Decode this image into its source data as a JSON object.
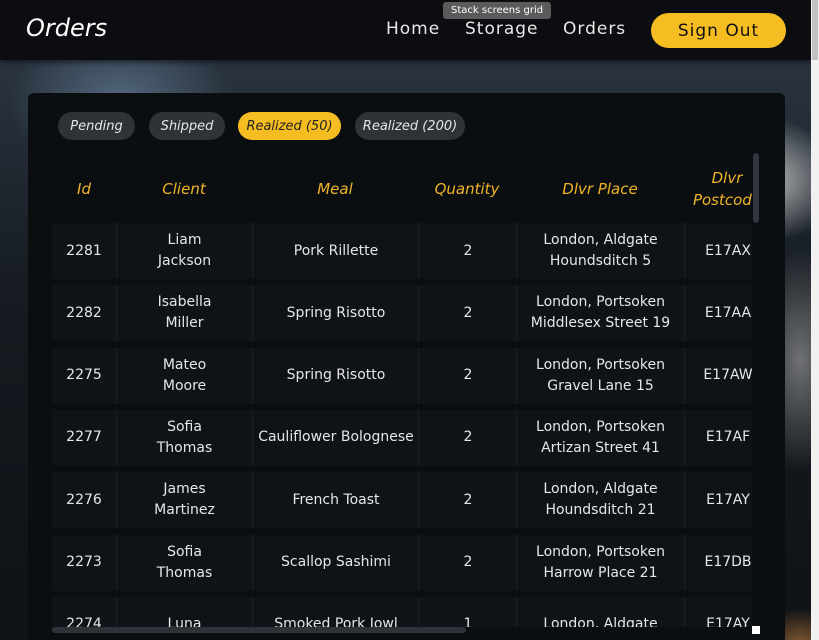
{
  "header": {
    "title": "Orders",
    "nav": [
      "Home",
      "Storage",
      "Orders"
    ],
    "tooltip": "Stack screens grid",
    "signout": "Sign Out"
  },
  "tabs": [
    {
      "label": "Pending",
      "active": false
    },
    {
      "label": "Shipped",
      "active": false
    },
    {
      "label": "Realized (50)",
      "active": true
    },
    {
      "label": "Realized (200)",
      "active": false
    }
  ],
  "table": {
    "columns": [
      "Id",
      "Client",
      "Meal",
      "Quantity",
      "Dlvr Place",
      "Dlvr Postcode"
    ],
    "rows": [
      {
        "id": "2281",
        "client": "Liam Jackson",
        "meal": "Pork Rillette",
        "qty": "2",
        "place": "London, Aldgate Houndsditch 5",
        "postcode": "E17AX"
      },
      {
        "id": "2282",
        "client": "Isabella Miller",
        "meal": "Spring Risotto",
        "qty": "2",
        "place": "London, Portsoken Middlesex Street 19",
        "postcode": "E17AA"
      },
      {
        "id": "2275",
        "client": "Mateo Moore",
        "meal": "Spring Risotto",
        "qty": "2",
        "place": "London, Portsoken Gravel Lane 15",
        "postcode": "E17AW"
      },
      {
        "id": "2277",
        "client": "Sofia Thomas",
        "meal": "Cauliflower Bolognese",
        "qty": "2",
        "place": "London, Portsoken Artizan Street 41",
        "postcode": "E17AF"
      },
      {
        "id": "2276",
        "client": "James Martinez",
        "meal": "French Toast",
        "qty": "2",
        "place": "London, Aldgate Houndsditch 21",
        "postcode": "E17AY"
      },
      {
        "id": "2273",
        "client": "Sofia Thomas",
        "meal": "Scallop Sashimi",
        "qty": "2",
        "place": "London, Portsoken Harrow Place 21",
        "postcode": "E17DB"
      },
      {
        "id": "2274",
        "client": "Luna",
        "meal": "Smoked Pork Jowl",
        "qty": "1",
        "place": "London, Aldgate",
        "postcode": "E17AY"
      }
    ]
  },
  "colors": {
    "accent": "#f5bd21",
    "header_text": "#f0b429"
  }
}
